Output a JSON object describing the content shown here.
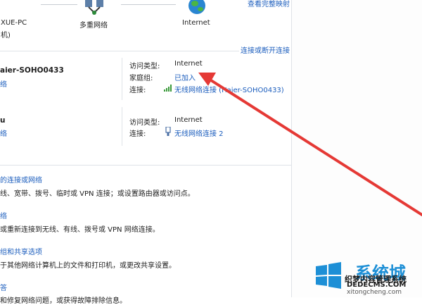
{
  "top_link": "查看完整映射",
  "map": {
    "pc_label_line1": "XUE-PC",
    "pc_label_line2": "机)",
    "multi_network_label": "多重网络",
    "internet_label": "Internet"
  },
  "connect_disconnect_link": "连接或断开连接",
  "networks": [
    {
      "name": "aier-SOHO0433",
      "type_link": "络",
      "access_type_label": "访问类型:",
      "access_type_value": "Internet",
      "homegroup_label": "家庭组:",
      "homegroup_value": "已加入",
      "connection_label": "连接:",
      "connection_value": "无线网络连接 (Haier-SOHO0433)"
    },
    {
      "name": "u",
      "type_link": "络",
      "access_type_label": "访问类型:",
      "access_type_value": "Internet",
      "connection_label": "连接:",
      "connection_value": "无线网络连接 2"
    }
  ],
  "tasks": [
    {
      "title": "的连接或网络",
      "desc": "线、宽带、拨号、临时或 VPN 连接；或设置路由器或访问点。"
    },
    {
      "title": "络",
      "desc": "或重新连接到无线、有线、拨号或 VPN 网络连接。"
    },
    {
      "title": "组和共享选项",
      "desc": "于其他网络计算机上的文件和打印机，或更改共享设置。"
    },
    {
      "title": "答",
      "desc": "和修复网络问题，或获得故障排除信息。"
    }
  ],
  "watermark": {
    "brand": "系统城",
    "line1": "织梦内容管理系统",
    "line2": "DEDECMS.COM",
    "line3": "xitongcheng.com"
  },
  "colors": {
    "link": "#1b5dbd",
    "arrow": "#e53935",
    "divider": "#dfe3e8"
  }
}
